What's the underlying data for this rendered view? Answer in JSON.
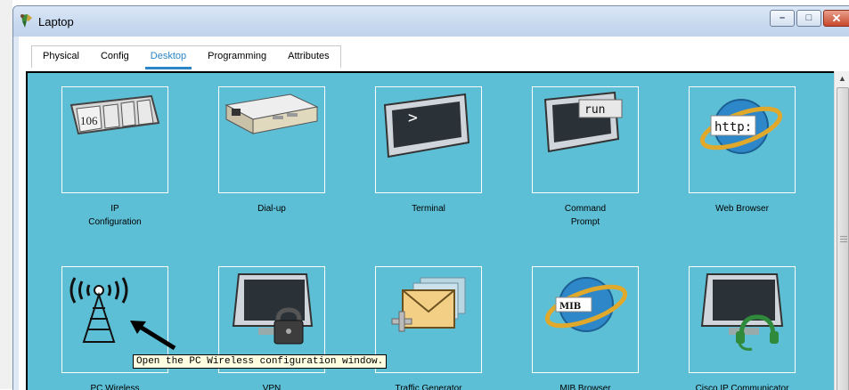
{
  "window": {
    "title": "Laptop",
    "buttons": {
      "minimize": "–",
      "maximize": "□",
      "close": "✕"
    }
  },
  "tabs": [
    {
      "label": "Physical"
    },
    {
      "label": "Config"
    },
    {
      "label": "Desktop",
      "active": true
    },
    {
      "label": "Programming"
    },
    {
      "label": "Attributes"
    }
  ],
  "apps": [
    {
      "label_line1": "IP",
      "label_line2": "Configuration",
      "icon": "ip-config-icon",
      "icon_text": "106"
    },
    {
      "label_line1": "Dial-up",
      "label_line2": "",
      "icon": "modem-icon"
    },
    {
      "label_line1": "Terminal",
      "label_line2": "",
      "icon": "terminal-icon",
      "icon_text": ">"
    },
    {
      "label_line1": "Command",
      "label_line2": "Prompt",
      "icon": "command-prompt-icon",
      "icon_text": "run"
    },
    {
      "label_line1": "Web Browser",
      "label_line2": "",
      "icon": "web-browser-icon",
      "icon_text": "http:"
    },
    {
      "label_line1": "PC Wireless",
      "label_line2": "",
      "icon": "wireless-tower-icon"
    },
    {
      "label_line1": "VPN",
      "label_line2": "",
      "icon": "vpn-lock-icon"
    },
    {
      "label_line1": "Traffic Generator",
      "label_line2": "",
      "icon": "envelope-icon"
    },
    {
      "label_line1": "MIB Browser",
      "label_line2": "",
      "icon": "mib-browser-icon",
      "icon_text": "MIB"
    },
    {
      "label_line1": "Cisco IP Communicator",
      "label_line2": "",
      "icon": "headset-monitor-icon"
    }
  ],
  "tooltip": "Open the PC Wireless configuration window.",
  "colors": {
    "desktop_bg": "#5dbfd6",
    "active_tab": "#2a86c7"
  }
}
